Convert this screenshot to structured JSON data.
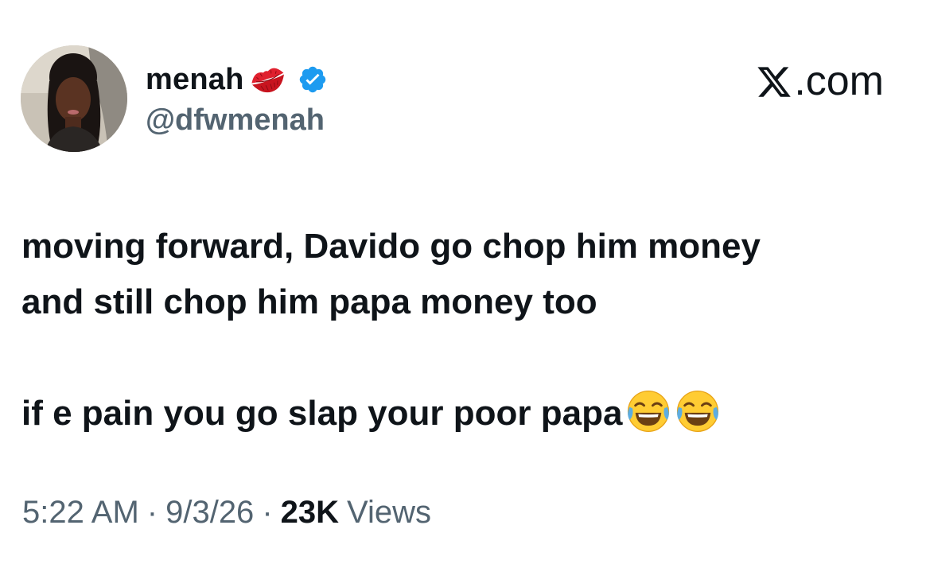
{
  "author": {
    "display_name": "menah",
    "handle": "@dfwmenah",
    "name_emoji_icon": "kiss-mark-icon",
    "verified_icon": "verified-badge-icon",
    "verified_color": "#1d9bf0"
  },
  "brand": {
    "label": ".com",
    "icon": "x-logo-icon"
  },
  "tweet": {
    "line1": "moving forward, Davido go chop him money",
    "line2": "and still chop him papa money too",
    "line3": "if e pain you go slap your poor papa",
    "trailing_emoji_icon": "face-with-tears-of-joy-icon"
  },
  "meta": {
    "time": "5:22 AM",
    "separator": "·",
    "date": "9/3/26",
    "views_count": "23K",
    "views_label": "Views"
  },
  "colors": {
    "text_primary": "#0f1419",
    "text_secondary": "#536471",
    "background": "#ffffff"
  }
}
